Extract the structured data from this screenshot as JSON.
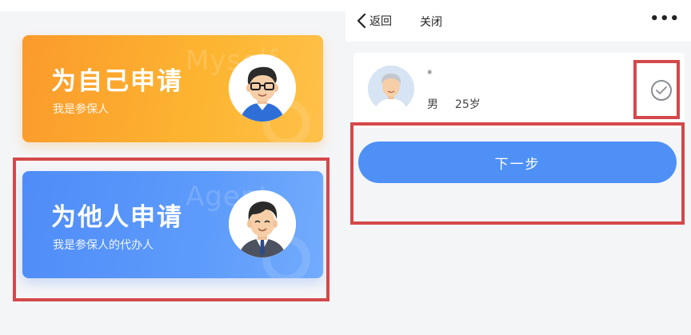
{
  "left": {
    "card_self": {
      "title": "为自己申请",
      "subtitle": "我是参保人",
      "watermark": "Myself",
      "gradient": [
        "#fb9a2c",
        "#fec14a"
      ]
    },
    "card_other": {
      "title": "为他人申请",
      "subtitle": "我是参保人的代办人",
      "watermark": "Agent",
      "gradient": [
        "#4f8cf8",
        "#73acfd"
      ]
    }
  },
  "right": {
    "nav": {
      "back_label": "返回",
      "close_label": "关闭",
      "more_label": "•••"
    },
    "person": {
      "name": "*",
      "gender": "男",
      "age": "25岁"
    },
    "next_button": "下一步"
  },
  "colors": {
    "primary": "#4e90f6",
    "highlight": "#d5484a",
    "orange": "#fdb531"
  }
}
